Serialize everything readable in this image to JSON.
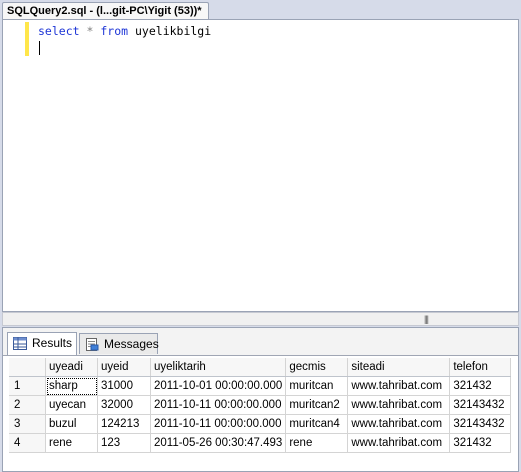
{
  "tab": {
    "title": "SQLQuery2.sql - (l...git-PC\\Yigit (53))*"
  },
  "editor": {
    "keyword_select": "select",
    "operator_star": "*",
    "keyword_from": "from",
    "table_name": "uyelikbilgi"
  },
  "results": {
    "tabs": [
      {
        "label": "Results"
      },
      {
        "label": "Messages"
      }
    ],
    "columns": [
      "uyeadi",
      "uyeid",
      "uyeliktarih",
      "gecmis",
      "siteadi",
      "telefon"
    ],
    "rows": [
      {
        "n": "1",
        "cells": [
          "sharp",
          "31000",
          "2011-10-01 00:00:00.000",
          "muritcan",
          "www.tahribat.com",
          "321432"
        ]
      },
      {
        "n": "2",
        "cells": [
          "uyecan",
          "32000",
          "2011-10-11 00:00:00.000",
          "muritcan2",
          "www.tahribat.com",
          "32143432"
        ]
      },
      {
        "n": "3",
        "cells": [
          "buzul",
          "124213",
          "2011-10-11 00:00:00.000",
          "muritcan4",
          "www.tahribat.com",
          "32143432"
        ]
      },
      {
        "n": "4",
        "cells": [
          "rene",
          "123",
          "2011-05-26 00:30:47.493",
          "rene",
          "www.tahribat.com",
          "321432"
        ]
      }
    ]
  },
  "colors": {
    "keyword": "#1d35d6",
    "change_bar": "#ffe64a",
    "chrome": "#d6dbe9"
  }
}
